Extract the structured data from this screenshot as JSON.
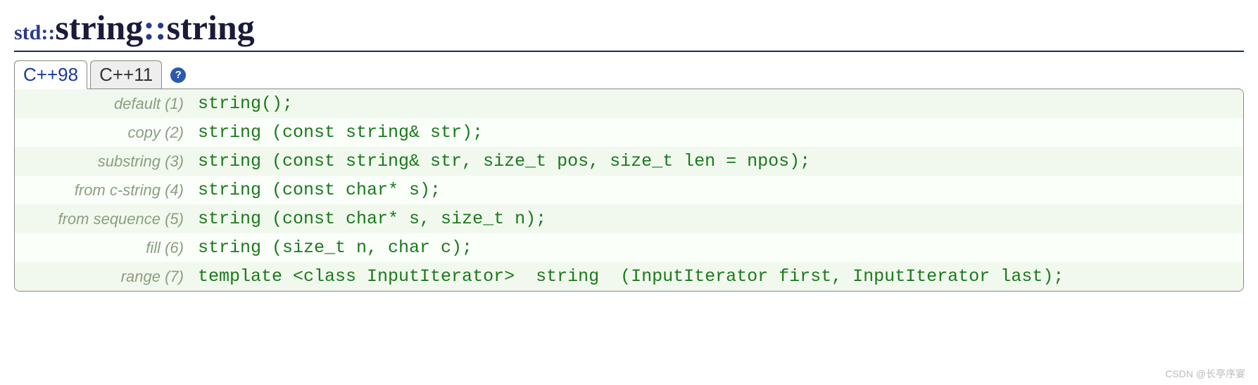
{
  "header": {
    "scope1": "std::",
    "name1": "string",
    "scope2": "::",
    "name2": "string"
  },
  "tabs": {
    "tab1": "C++98",
    "tab2": "C++11",
    "help": "?"
  },
  "signatures": [
    {
      "label": "default (1)",
      "code": "string();"
    },
    {
      "label": "copy (2)",
      "code": "string (const string& str);"
    },
    {
      "label": "substring (3)",
      "code": "string (const string& str, size_t pos, size_t len = npos);"
    },
    {
      "label": "from c-string (4)",
      "code": "string (const char* s);"
    },
    {
      "label": "from sequence (5)",
      "code": "string (const char* s, size_t n);"
    },
    {
      "label": "fill (6)",
      "code": "string (size_t n, char c);"
    },
    {
      "label": "range (7)",
      "code": "template <class InputIterator>  string  (InputIterator first, InputIterator last);"
    }
  ],
  "watermark": "CSDN @长亭序宴"
}
